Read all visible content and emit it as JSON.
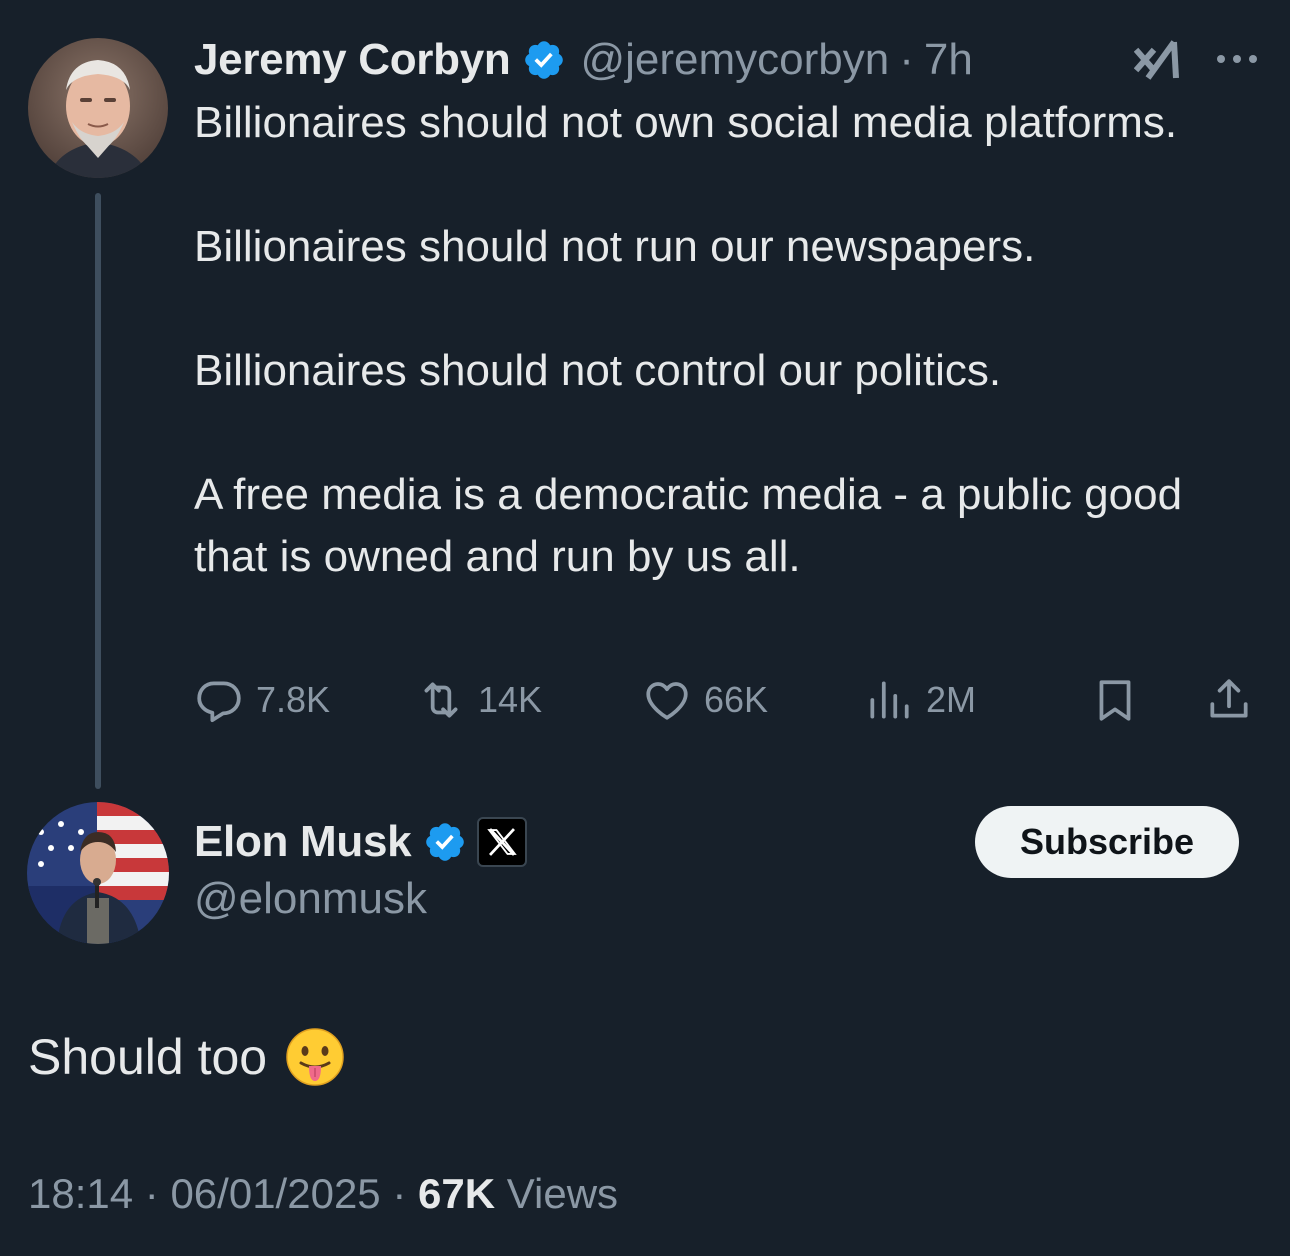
{
  "parent_tweet": {
    "author_name": "Jeremy Corbyn",
    "handle": "@jeremycorbyn",
    "separator": "·",
    "time_ago": "7h",
    "paragraphs": [
      "Billionaires should not own social media platforms.",
      "Billionaires should not run our newspapers.",
      "Billionaires should not control our politics.",
      "A free media is a democratic media - a public good that is owned and run by us all."
    ],
    "stats": {
      "replies": "7.8K",
      "reposts": "14K",
      "likes": "66K",
      "views": "2M"
    },
    "icons": [
      "verified-badge-icon",
      "grok-icon",
      "more-icon",
      "reply-icon",
      "repost-icon",
      "like-icon",
      "views-icon",
      "bookmark-icon",
      "share-icon"
    ]
  },
  "reply_tweet": {
    "author_name": "Elon Musk",
    "handle": "@elonmusk",
    "subscribe_label": "Subscribe",
    "text": "Should too",
    "emoji": "face-with-tongue",
    "time": "18:14",
    "date": "06/01/2025",
    "separator": "·",
    "views_count": "67K",
    "views_label": "Views",
    "icons": [
      "verified-badge-icon",
      "x-affiliate-icon"
    ]
  },
  "colors": {
    "background": "#17202a",
    "primary_text": "#e7e9ea",
    "secondary_text": "#8b98a5",
    "verified_blue": "#1d9bf0",
    "thread_line": "#3e4e5e",
    "button_bg": "#eff3f4"
  }
}
